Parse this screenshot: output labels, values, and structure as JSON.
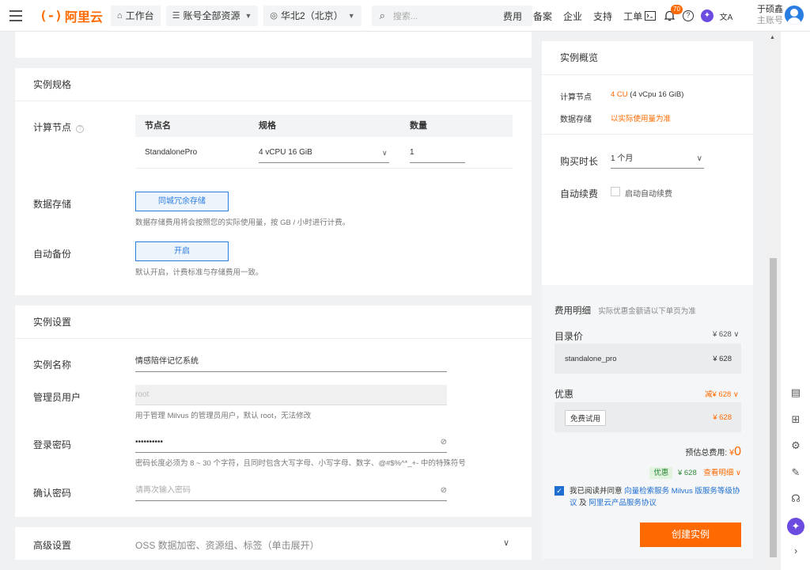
{
  "header": {
    "logo_mark": "(-)",
    "logo_text": "阿里云",
    "workbench": "工作台",
    "account_resources": "账号全部资源",
    "region": "华北2（北京）",
    "search_placeholder": "搜索...",
    "links": [
      "费用",
      "备案",
      "企业",
      "支持",
      "工单"
    ],
    "notification_count": "70",
    "user_name": "于硕鑫",
    "user_role": "主账号"
  },
  "spec": {
    "title": "实例规格",
    "compute_label": "计算节点",
    "table_headers": [
      "节点名",
      "规格",
      "数量"
    ],
    "node_name": "StandalonePro",
    "node_spec": "4 vCPU 16 GiB",
    "node_count": "1",
    "storage_label": "数据存储",
    "storage_option": "同城冗余存储",
    "storage_hint": "数据存储费用将会按照您的实际使用量，按 GB / 小时进行计费。",
    "backup_label": "自动备份",
    "backup_option": "开启",
    "backup_hint": "默认开启，计费标准与存储费用一致。"
  },
  "settings": {
    "title": "实例设置",
    "name_label": "实例名称",
    "name_value": "情感陪伴记忆系统",
    "admin_label": "管理员用户",
    "admin_value": "root",
    "admin_hint": "用于管理 Milvus 的管理员用户，默认 root，无法修改",
    "password_label": "登录密码",
    "password_value": "••••••••••",
    "password_hint": "密码长度必须为 8 ~ 30 个字符，且同时包含大写字母、小写字母、数字、@#$%^*_+- 中的特殊符号",
    "confirm_label": "确认密码",
    "confirm_placeholder": "请再次输入密码"
  },
  "advanced": {
    "label": "高级设置",
    "desc": "OSS 数据加密、资源组、标签（单击展开）"
  },
  "overview": {
    "title": "实例概览",
    "compute_label": "计算节点",
    "compute_value_hl": "4 CU",
    "compute_value_rest": " (4 vCpu 16 GiB)",
    "storage_label": "数据存储",
    "storage_value": "以实际使用量为准",
    "duration_label": "购买时长",
    "duration_value": "1 个月",
    "renew_label": "自动续费",
    "renew_option": "启动自动续费"
  },
  "cost": {
    "title": "费用明细",
    "subtitle": "实际优惠金额请以下单页为准",
    "list_label": "目录价",
    "list_value": "¥ 628",
    "item_name": "standalone_pro",
    "item_value": "¥ 628",
    "discount_label": "优惠",
    "discount_value": "减¥ 628",
    "trial_tag": "免费试用",
    "trial_value": "¥ 628",
    "total_label": "预估总费用: ",
    "total_currency": "¥",
    "total_value": "0",
    "promo_tag": "优惠",
    "promo_value": "¥ 628",
    "detail_link": "查看明细",
    "agree_prefix": "我已阅读并同意",
    "agree_link1": "向量检索服务 Milvus 版服务等级协议",
    "agree_mid": "及",
    "agree_link2": "阿里云产品服务协议",
    "create_button": "创建实例"
  }
}
